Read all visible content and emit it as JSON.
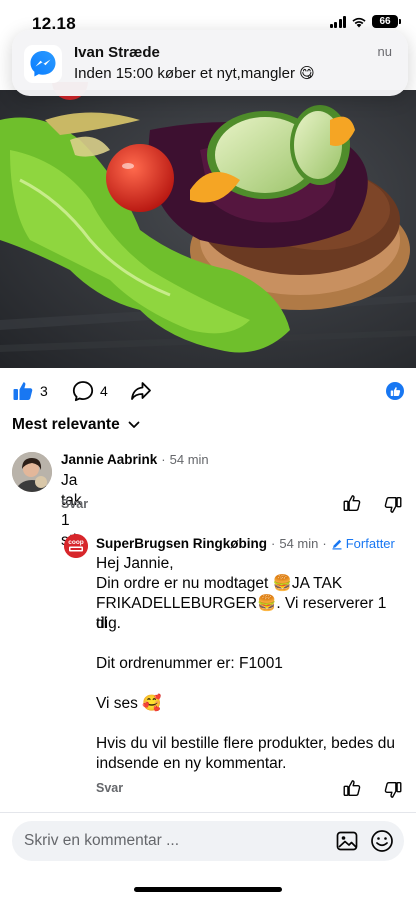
{
  "status_bar": {
    "time": "12.18",
    "battery": "66"
  },
  "notification": {
    "app_icon": "messenger-icon",
    "sender": "Ivan Stræde",
    "message": "Inden 15:00 køber et nyt,mangler 😋",
    "time": "nu"
  },
  "actions": {
    "like_count": "3",
    "comment_count": "4",
    "like_icon": "thumbs-up-icon",
    "comment_icon": "comment-bubble-icon",
    "share_icon": "share-arrow-icon",
    "reaction_icon": "like-reaction-icon"
  },
  "sort": {
    "label": "Mest relevante",
    "icon": "chevron-down-icon"
  },
  "comments": [
    {
      "author": "Jannie Aabrink",
      "time": "54 min",
      "text": "Ja tak 1 stk",
      "reply_label": "Svar"
    }
  ],
  "reply": {
    "author": "SuperBrugsen Ringkøbing",
    "time": "54 min",
    "badge": "Forfatter",
    "avatar_text": "coop",
    "avatar_subtext": "SuperBrugsen",
    "lines": [
      "Hej Jannie,",
      "Din ordre er nu modtaget 🍔JA TAK",
      "FRIKADELLEBURGER🍔. Vi reserverer 1 til",
      "dig.",
      "",
      "Dit ordrenummer er: F1001",
      "",
      "Vi ses 🥰",
      "",
      "Hvis du vil bestille flere produkter, bedes du",
      "indsende en ny kommentar."
    ],
    "reply_label": "Svar"
  },
  "composer": {
    "placeholder": "Skriv en kommentar ...",
    "photo_icon": "photo-icon",
    "emoji_icon": "smiley-icon"
  },
  "colors": {
    "accent": "#1877f2",
    "brand_red": "#d7262b",
    "secondary_text": "#65676b"
  }
}
